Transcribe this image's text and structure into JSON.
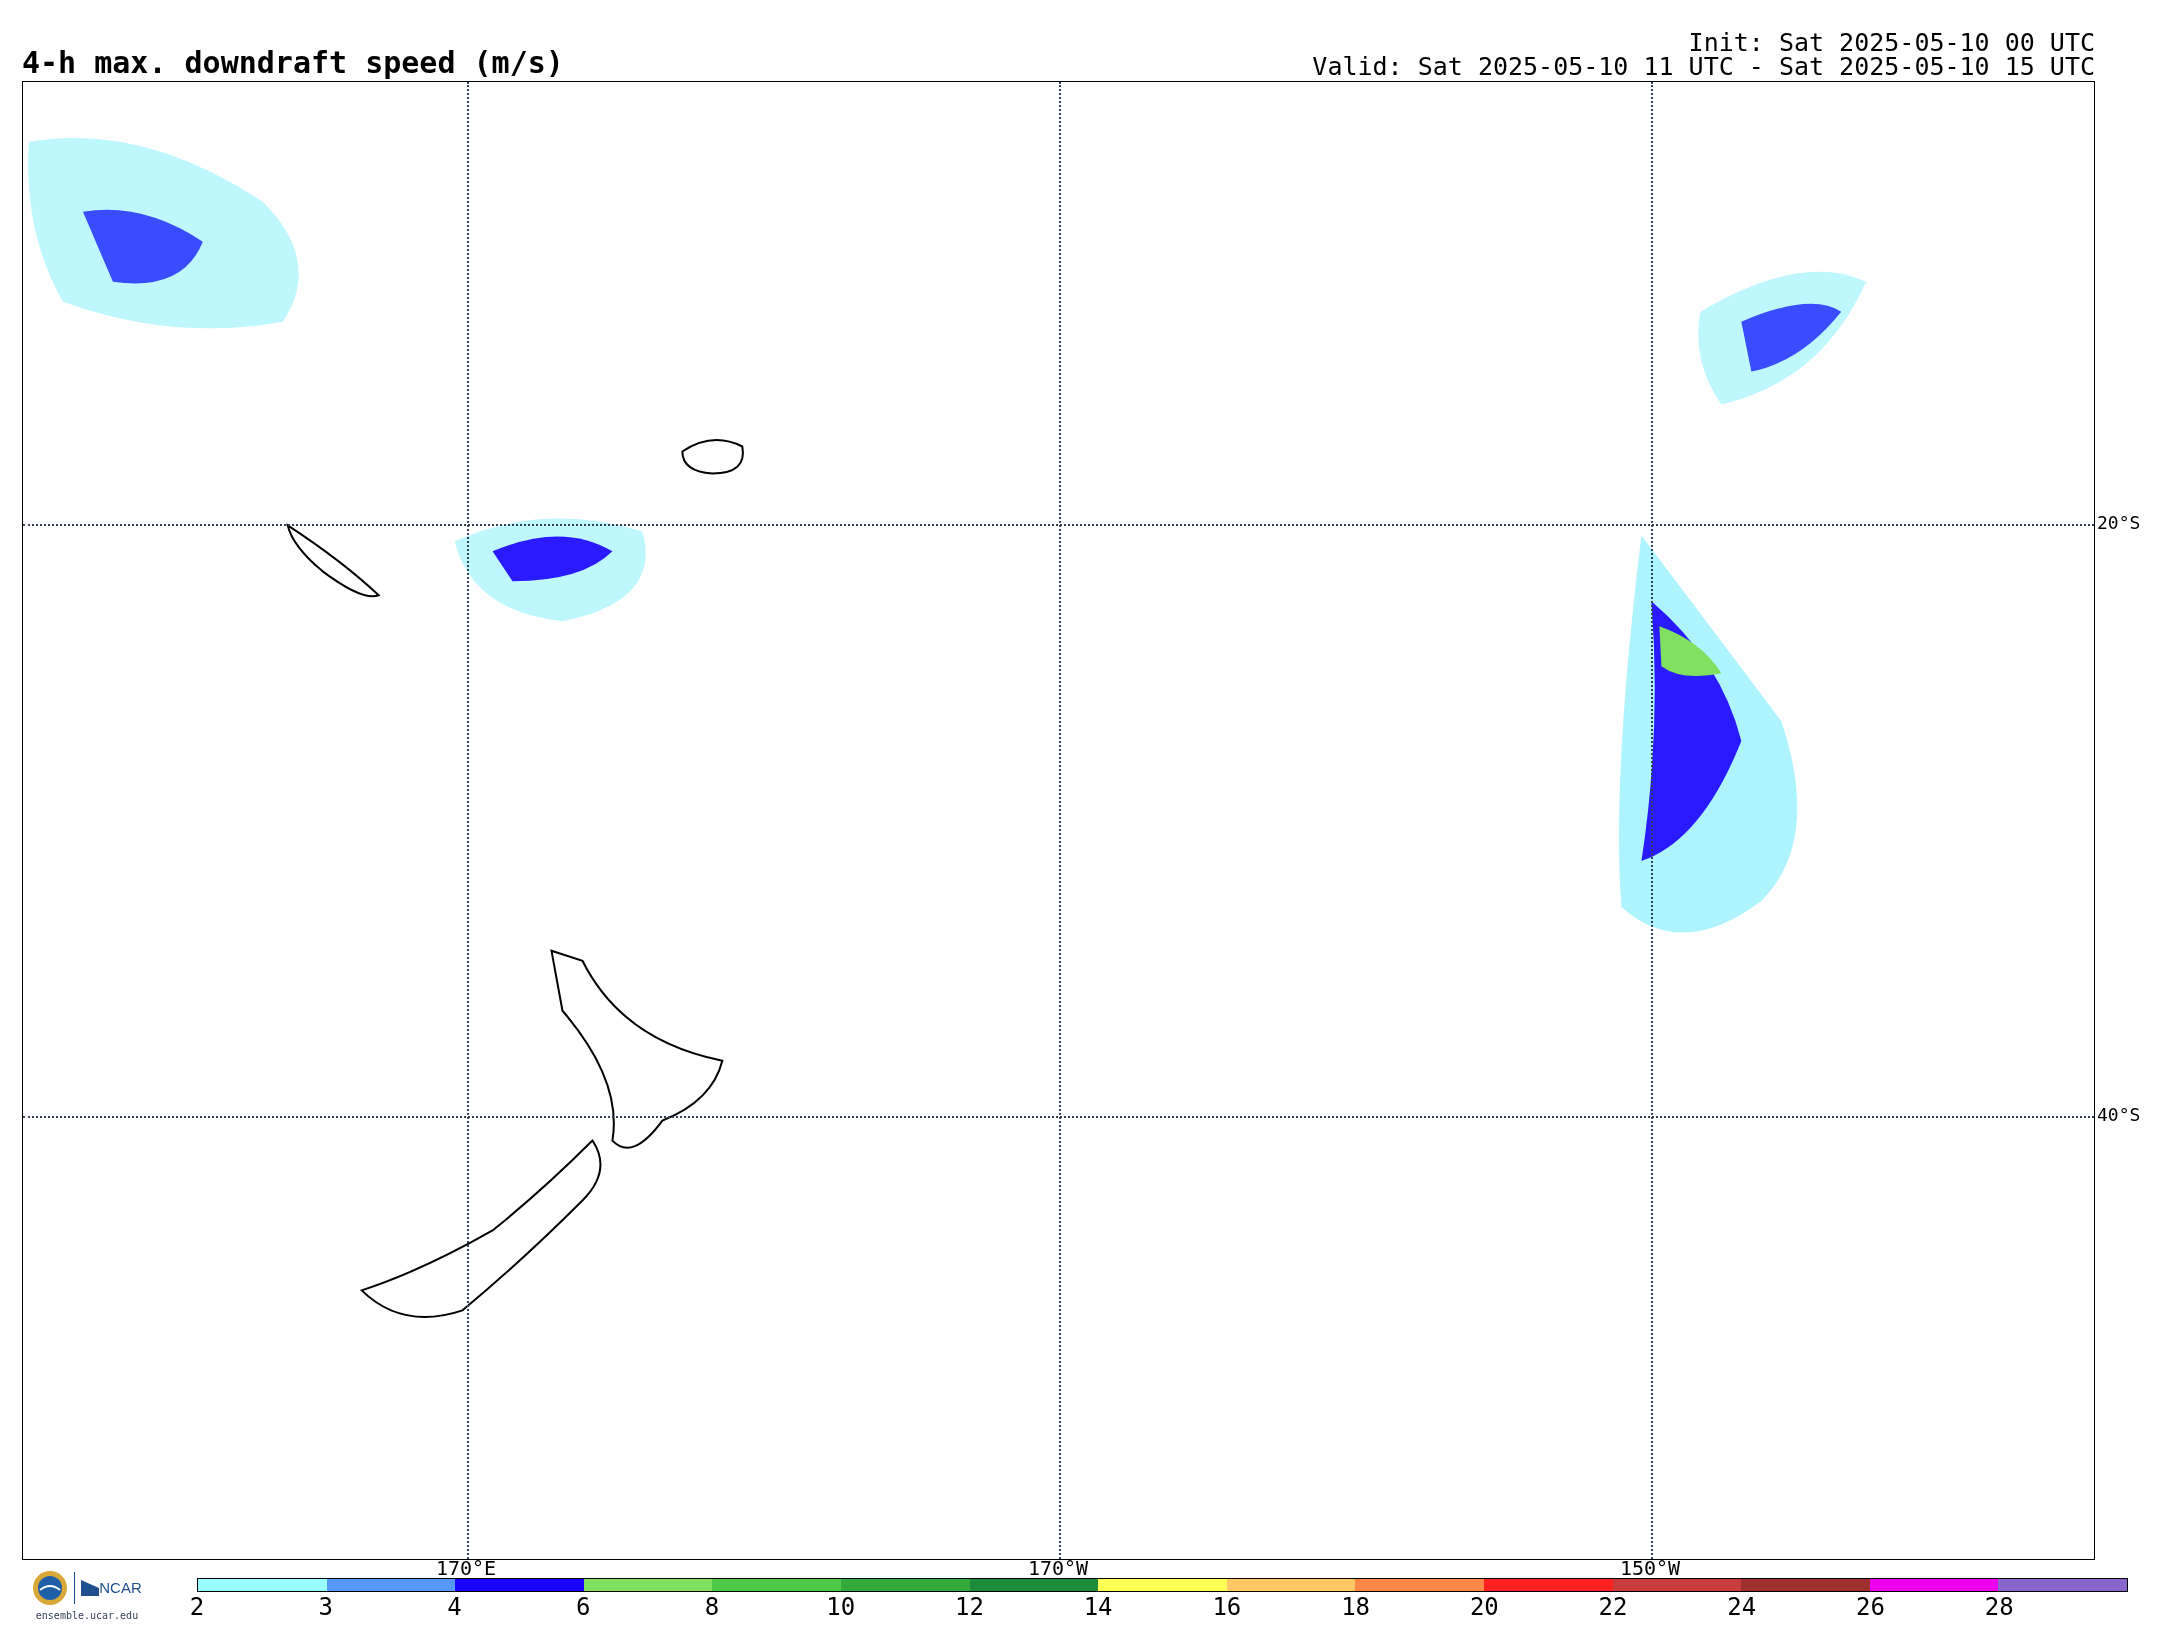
{
  "title": "4-h max. downdraft speed (m/s)",
  "init": "Init: Sat 2025-05-10 00 UTC",
  "valid": "Valid: Sat 2025-05-10 11 UTC - Sat 2025-05-10 15 UTC",
  "map": {
    "latitude_labels": [
      "20°S",
      "40°S"
    ],
    "longitude_labels": [
      "170°E",
      "170°W",
      "150°W"
    ]
  },
  "logos": {
    "ncar": "NCAR",
    "url": "ensemble.ucar.edu"
  },
  "colorbar": {
    "bins": [
      {
        "color": "#99ffff"
      },
      {
        "color": "#5599ff"
      },
      {
        "color": "#1a00ff"
      },
      {
        "color": "#80e060"
      },
      {
        "color": "#4dc848"
      },
      {
        "color": "#33aa3a"
      },
      {
        "color": "#1e8c3c"
      },
      {
        "color": "#ffff55"
      },
      {
        "color": "#ffc864"
      },
      {
        "color": "#ff8848"
      },
      {
        "color": "#ff2020"
      },
      {
        "color": "#c83c3c"
      },
      {
        "color": "#a03030"
      },
      {
        "color": "#ee00ee"
      },
      {
        "color": "#8866cc"
      }
    ],
    "tick_labels": [
      "2",
      "3",
      "4",
      "6",
      "8",
      "10",
      "12",
      "14",
      "16",
      "18",
      "20",
      "22",
      "24",
      "26",
      "28"
    ]
  }
}
